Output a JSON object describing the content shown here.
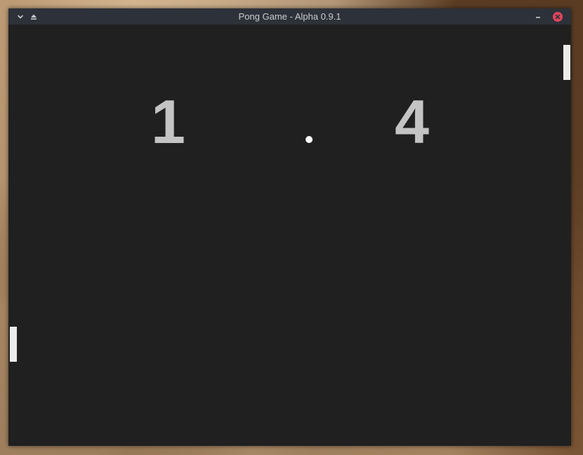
{
  "window": {
    "title": "Pong Game - Alpha 0.9.1",
    "buttons": {
      "menu_icon": "chevron-down-icon",
      "keep_above_icon": "eject-icon",
      "minimize_icon": "minimize-icon",
      "close_icon": "close-icon"
    },
    "close_color": "#e0445b"
  },
  "game": {
    "score_left": "1",
    "score_right": "4",
    "background_color": "#202020",
    "score_color": "#c4c4c4",
    "paddle_color": "#ececec",
    "ball_color": "#ffffff"
  }
}
